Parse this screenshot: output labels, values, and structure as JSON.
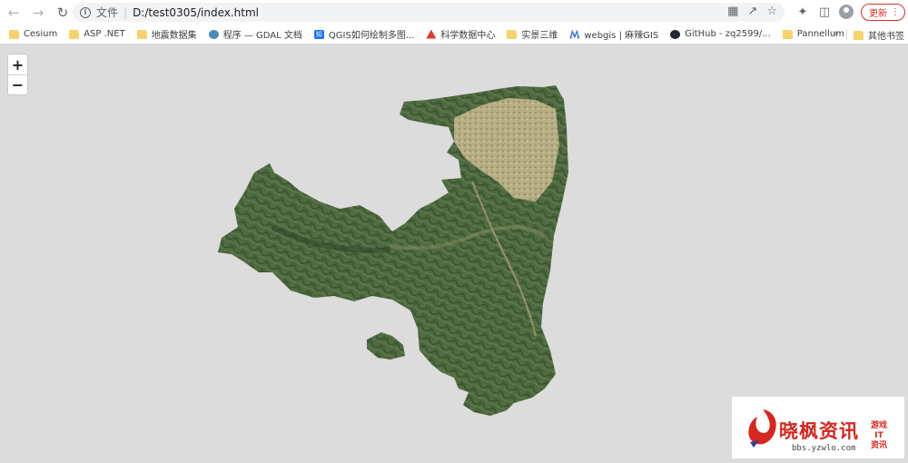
{
  "browser": {
    "scheme_label": "文件",
    "url": "D:/test0305/index.html",
    "update_label": "更新"
  },
  "bookmarks": [
    {
      "label": "Cesium",
      "icon": "folder-icon"
    },
    {
      "label": "ASP .NET",
      "icon": "folder-icon"
    },
    {
      "label": "地震数据集",
      "icon": "folder-icon"
    },
    {
      "label": "程序 — GDAL 文档",
      "icon": "gdal-icon"
    },
    {
      "label": "QGIS如何绘制多图...",
      "icon": "zhihu-icon"
    },
    {
      "label": "科学数据中心",
      "icon": "science-icon"
    },
    {
      "label": "实景三维",
      "icon": "folder-icon"
    },
    {
      "label": "webgis | 麻辣GIS",
      "icon": "malagis-icon"
    },
    {
      "label": "GitHub - zq2599/...",
      "icon": "github-icon"
    },
    {
      "label": "Pannellum",
      "icon": "folder-icon"
    }
  ],
  "bookmarks_more": "»",
  "other_bookmarks": "其他书签",
  "map": {
    "zoom_in": "+",
    "zoom_out": "−"
  },
  "watermark": {
    "title": "晓枫资讯",
    "url": "bbs.yzwlo.com",
    "side_line1": "游戏",
    "side_line2": "IT",
    "side_line3": "资讯"
  }
}
